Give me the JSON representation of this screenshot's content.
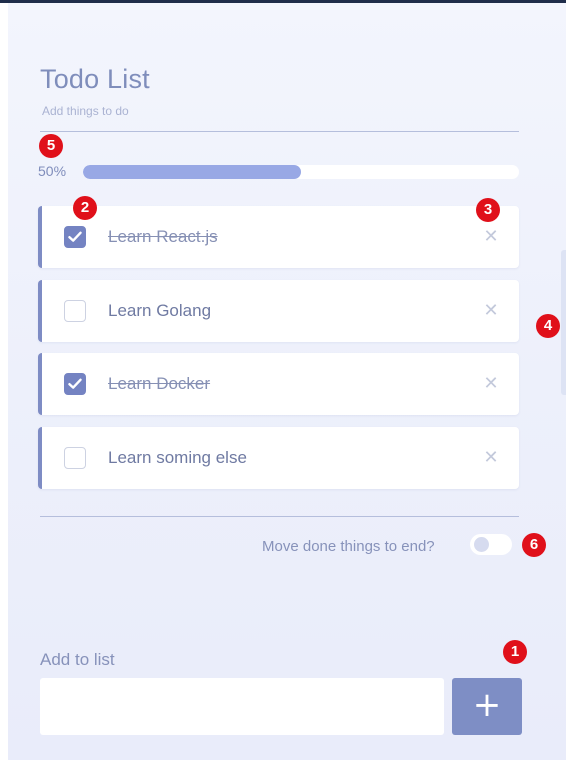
{
  "header": {
    "title": "Todo List",
    "subtitle": "Add things to do"
  },
  "progress": {
    "percent_text": "50%",
    "value": 0.5
  },
  "todos": [
    {
      "label": "Learn React.js",
      "done": true
    },
    {
      "label": "Learn Golang",
      "done": false
    },
    {
      "label": "Learn Docker",
      "done": true
    },
    {
      "label": "Learn soming else",
      "done": false
    }
  ],
  "delete_glyph": "✕",
  "options": {
    "move_done_label": "Move done things to end?",
    "move_done_enabled": false
  },
  "add": {
    "label": "Add to list",
    "input_value": "",
    "placeholder": "",
    "button_glyph": "+"
  },
  "annotations": [
    "1",
    "2",
    "3",
    "4",
    "5",
    "6"
  ],
  "colors": {
    "accent": "#7e8ec5",
    "progress_fill": "#98a8e5",
    "badge": "#e0101a",
    "text": "#7f8dbb"
  }
}
